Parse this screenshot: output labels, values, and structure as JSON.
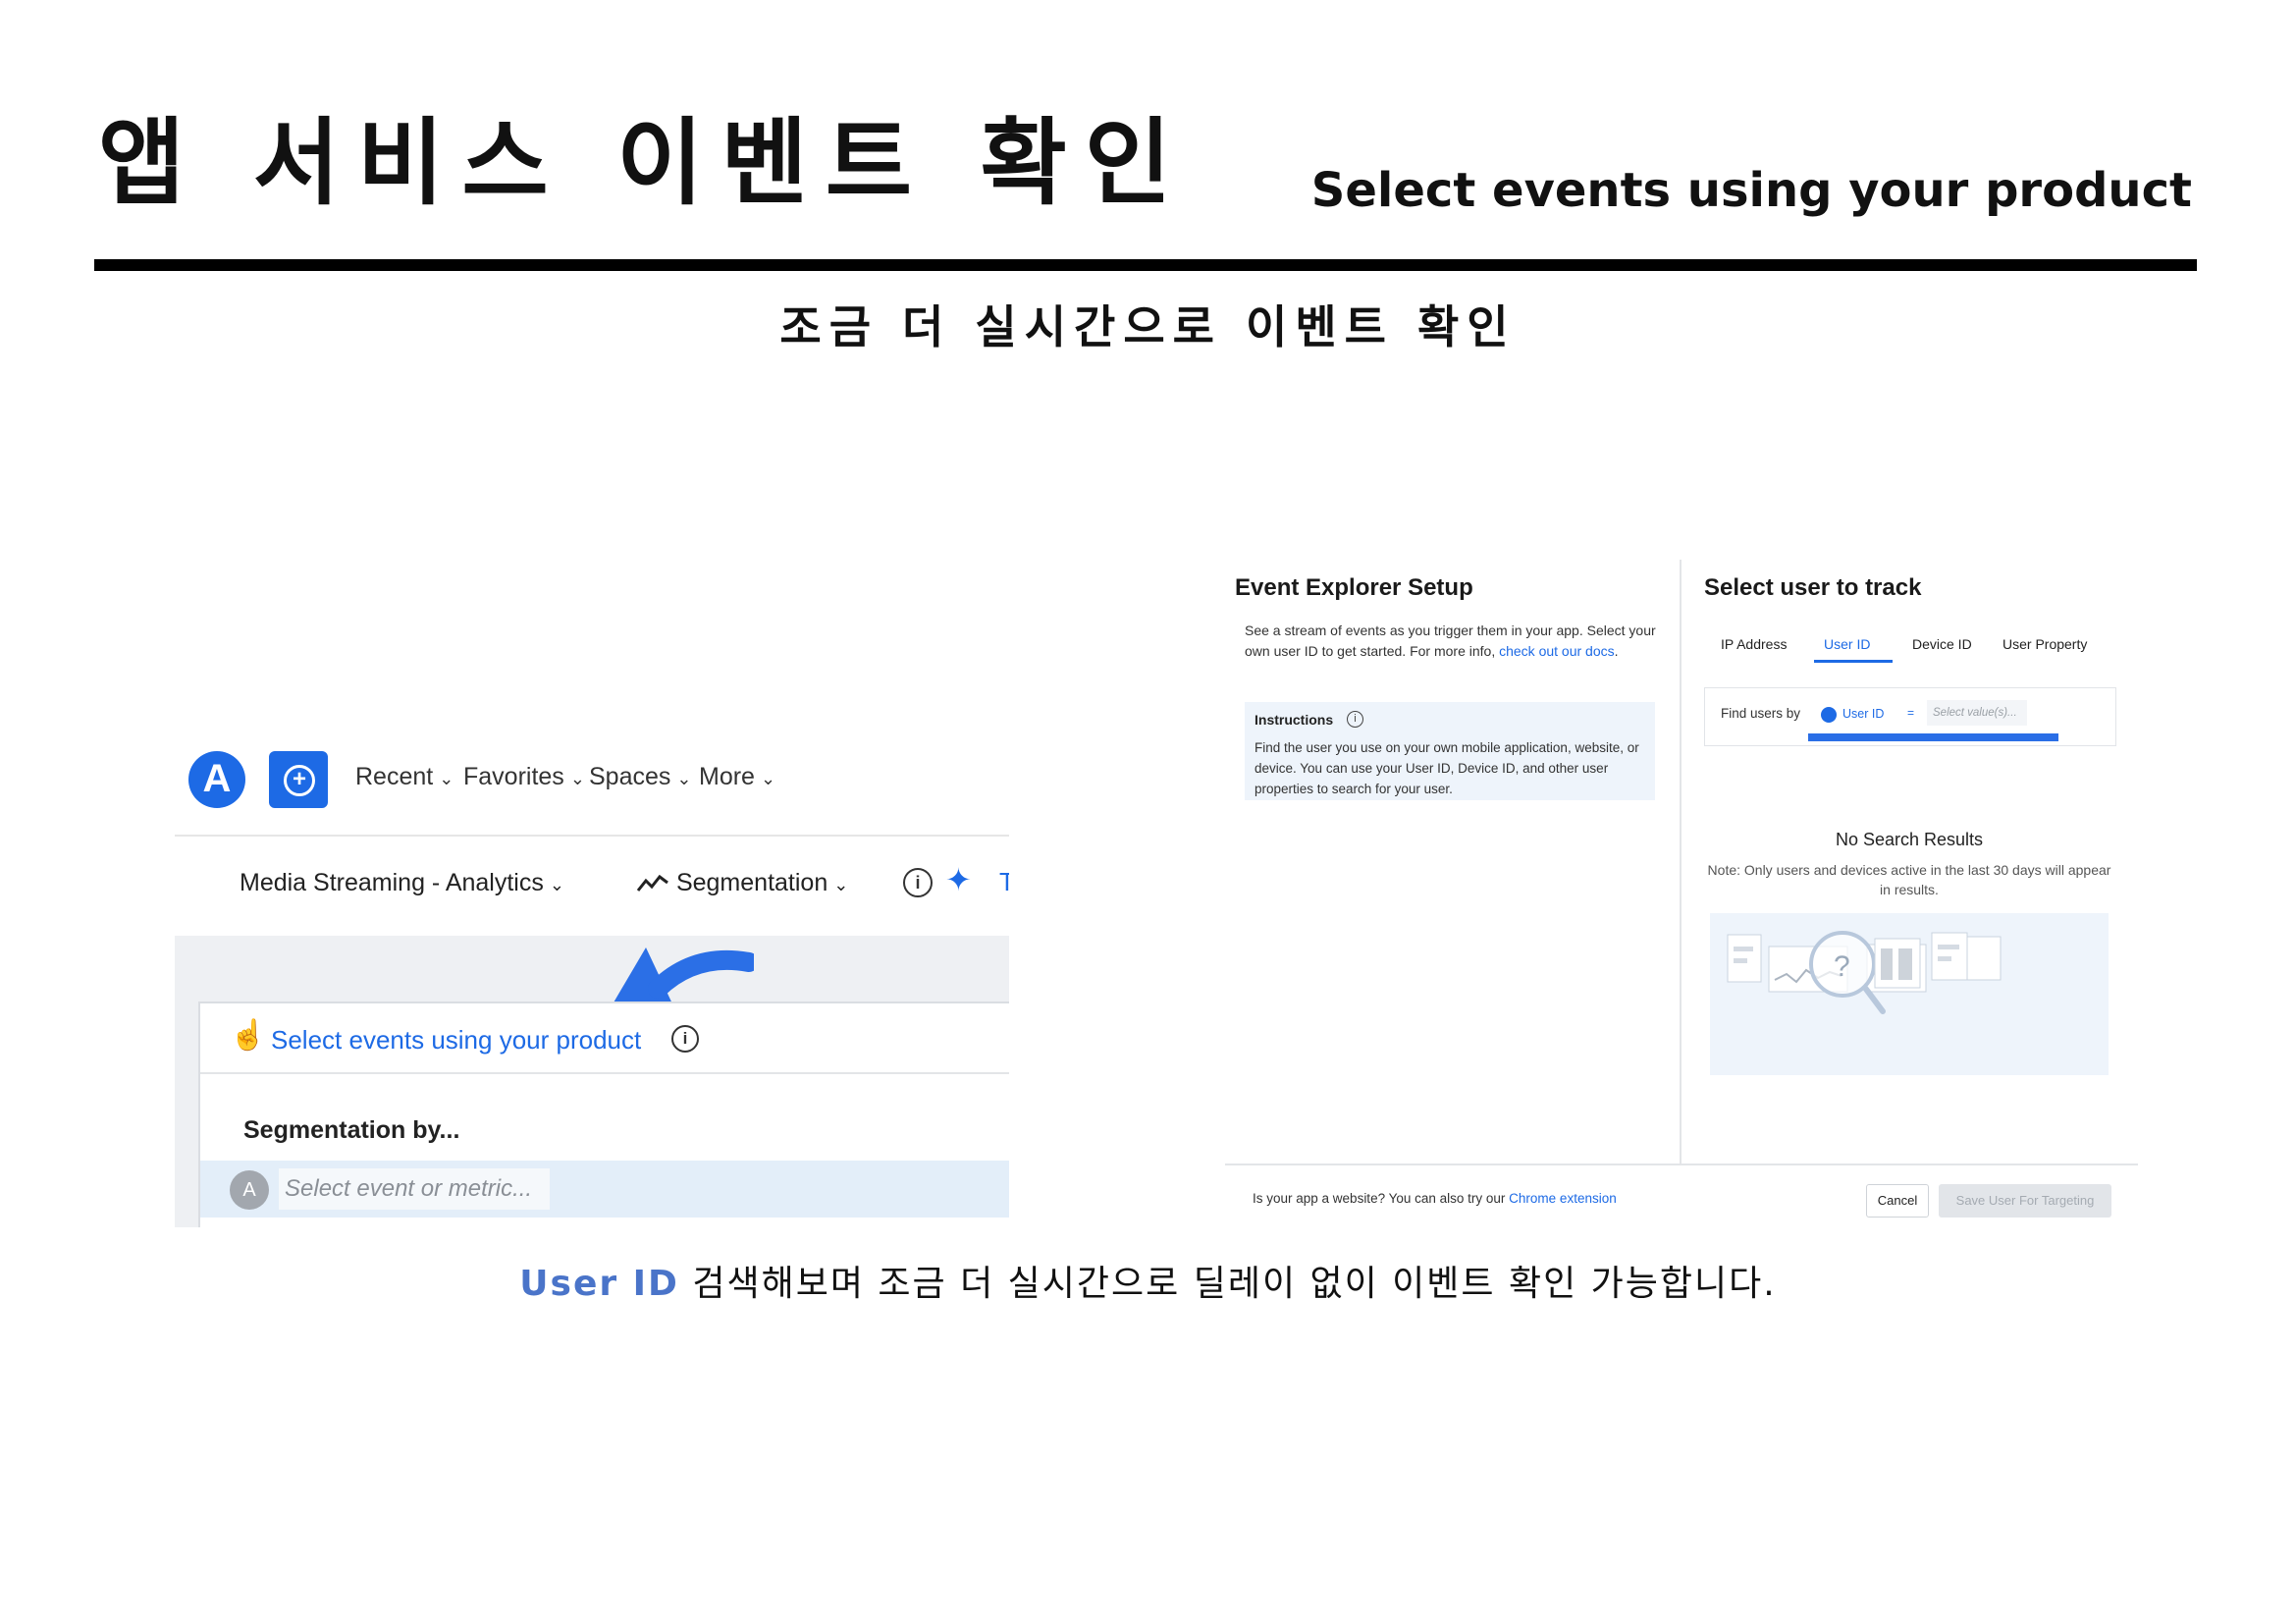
{
  "slide": {
    "title": "앱 서비스 이벤트 확인",
    "subtitle": "Select events using your product",
    "section_title": "조금 더 실시간으로 이벤트 확인",
    "caption_highlight": "User ID",
    "caption_rest": " 검색해보며 조금 더 실시간으로 딜레이 없이 이벤트 확인 가능합니다."
  },
  "left_shot": {
    "nav": {
      "logo_letter": "A",
      "add_symbol": "+",
      "items": [
        "Recent",
        "Favorites",
        "Spaces",
        "More"
      ]
    },
    "toolbar": {
      "project": "Media Streaming - Analytics",
      "chart_type": "Segmentation",
      "info": "i",
      "cut_text": "T"
    },
    "panel": {
      "title": "Select events using your product",
      "info": "i",
      "segmentation_label": "Segmentation by...",
      "avatar_letter": "A",
      "select_placeholder": "Select event or metric..."
    }
  },
  "right_shot": {
    "setup": {
      "title": "Event Explorer Setup",
      "desc": "See a stream of events as you trigger them in your app. Select your own user ID to get started. For more info, ",
      "desc_link": "check out our docs",
      "desc_end": ".",
      "instructions_title": "Instructions",
      "instructions_text": "Find the user you use on your own mobile application, website, or device. You can use your User ID, Device ID, and other user properties to search for your user."
    },
    "track": {
      "title": "Select user to track",
      "tabs": [
        "IP Address",
        "User ID",
        "Device ID",
        "User Property"
      ],
      "active_tab": "User ID",
      "find_label": "Find users by",
      "chip": "User ID",
      "operator": "=",
      "value_placeholder": "Select value(s)...",
      "no_results_title": "No Search Results",
      "no_results_note": "Note: Only users and devices active in the last 30 days will appear in results."
    },
    "footer": {
      "text": "Is your app a website? You can also try our ",
      "link": "Chrome extension",
      "cancel": "Cancel",
      "save": "Save User For Targeting"
    },
    "colors": {
      "accent": "#1d6ae5",
      "panel_bg": "#eef4fb"
    }
  }
}
